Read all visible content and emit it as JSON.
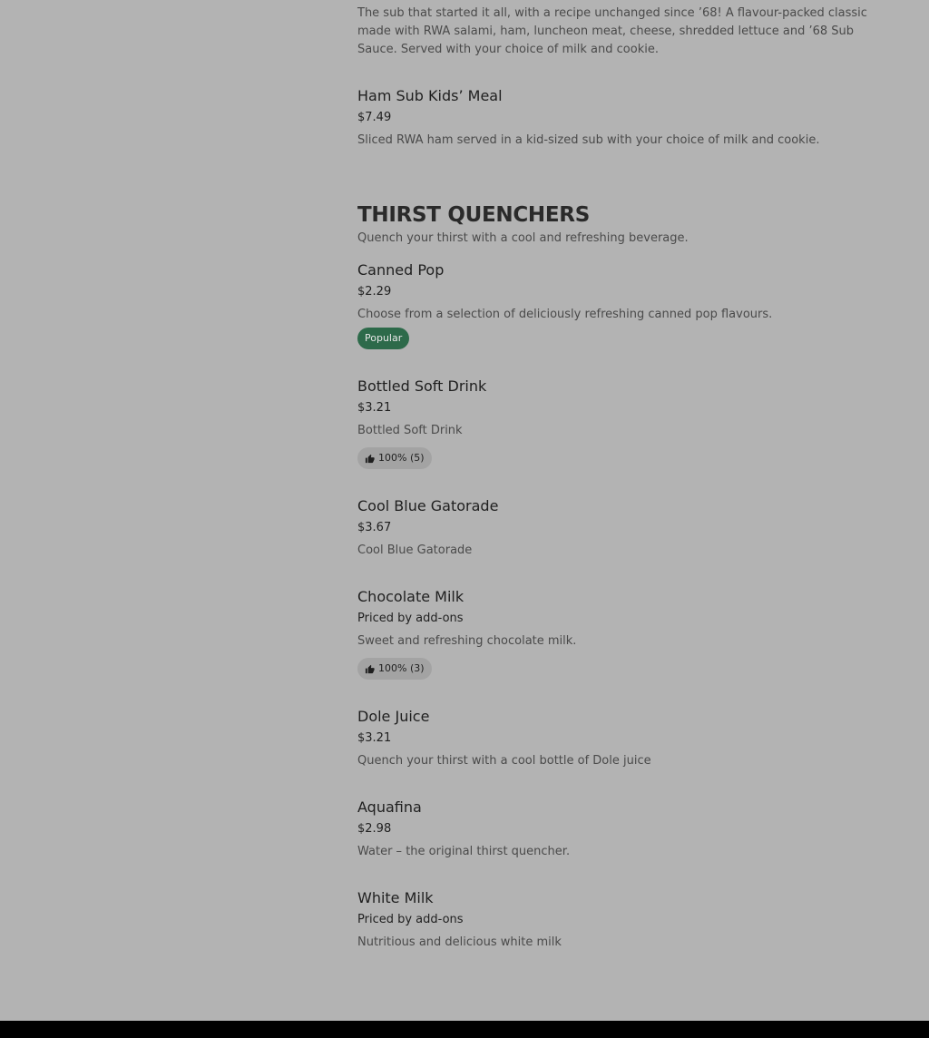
{
  "kids_section": {
    "top_item_desc": "The sub that started it all, with a recipe unchanged since ’68! A flavour-packed classic made with RWA salami, ham, luncheon meat, cheese, shredded lettuce and ’68 Sub Sauce. Served with your choice of milk and cookie.",
    "ham_sub": {
      "name": "Ham Sub Kids’ Meal",
      "price": "$7.49",
      "desc": "Sliced RWA ham served in a kid-sized sub with your choice of milk and cookie."
    }
  },
  "section": {
    "title": "THIRST QUENCHERS",
    "subtitle": "Quench your thirst with a cool and refreshing beverage."
  },
  "items": [
    {
      "name": "Canned Pop",
      "price": "$2.29",
      "desc": "Choose from a selection of deliciously refreshing canned pop flavours.",
      "badge": "Popular"
    },
    {
      "name": "Bottled Soft Drink",
      "price": "$3.21",
      "desc": "Bottled Soft Drink",
      "rating": "100% (5)"
    },
    {
      "name": "Cool Blue Gatorade",
      "price": "$3.67",
      "desc": "Cool Blue Gatorade"
    },
    {
      "name": "Chocolate Milk",
      "price": "Priced by add-ons",
      "desc": "Sweet and refreshing chocolate milk.",
      "rating": "100% (3)"
    },
    {
      "name": "Dole Juice",
      "price": "$3.21",
      "desc": "Quench your thirst with a cool bottle of Dole juice"
    },
    {
      "name": "Aquafina",
      "price": "$2.98",
      "desc": "Water – the original thirst quencher."
    },
    {
      "name": "White Milk",
      "price": "Priced by add-ons",
      "desc": "Nutritious and delicious white milk"
    }
  ],
  "icons": {
    "rating": "thumbs-up-icon"
  },
  "colors": {
    "overlay_background": "#b3b3b3",
    "popular_badge": "#2d6a4a",
    "rating_badge": "#a3a3a3",
    "footer": "#000000"
  }
}
